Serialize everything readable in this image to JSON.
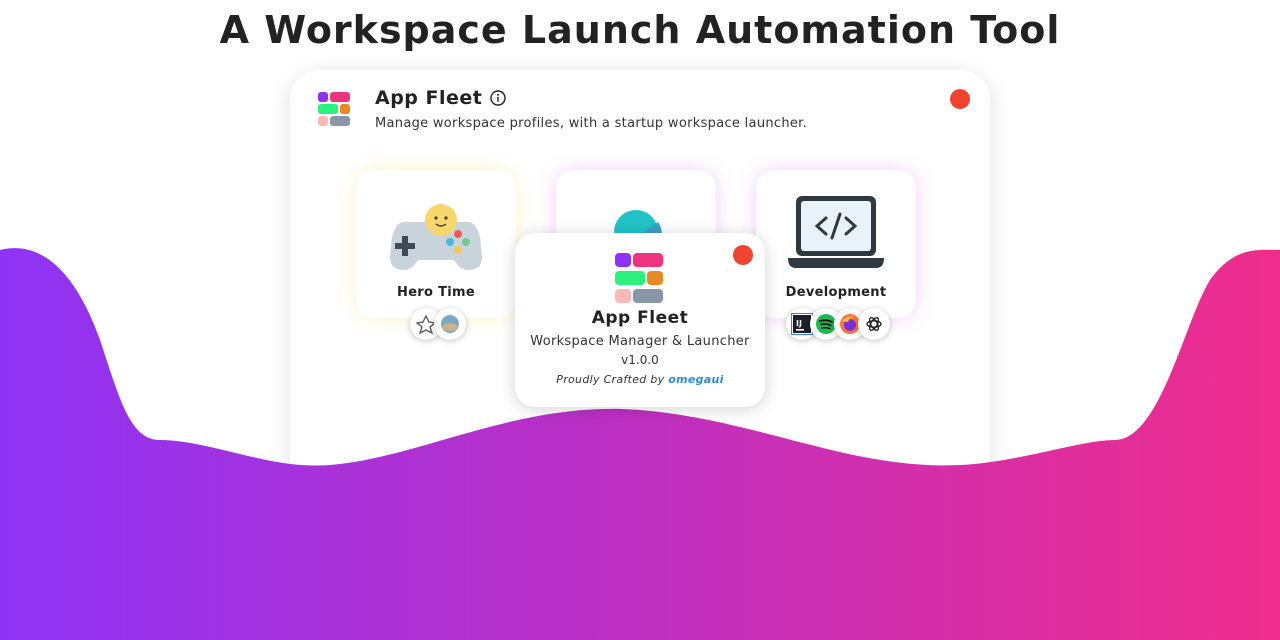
{
  "headline": "A Workspace Launch Automation Tool",
  "app": {
    "title": "App Fleet",
    "subtitle": "Manage workspace profiles, with a startup workspace launcher."
  },
  "workspaces": [
    {
      "label": "Hero Time",
      "icon": "gamepad-icon",
      "apps": [
        "game-app-1-icon",
        "game-app-2-icon"
      ]
    },
    {
      "label": "",
      "icon": "person-icon",
      "apps": []
    },
    {
      "label": "Development",
      "icon": "laptop-code-icon",
      "apps": [
        "intellij-icon",
        "spotify-icon",
        "firefox-icon",
        "openai-icon"
      ]
    }
  ],
  "about": {
    "name": "App Fleet",
    "description": "Workspace Manager & Launcher",
    "version": "v1.0.0",
    "credit_prefix": "Proudly Crafted by",
    "author": "omegaui"
  },
  "colors": {
    "close": "#f04430",
    "wave_start": "#8e33f5",
    "wave_end": "#ef2d8c",
    "author_link": "#2d8ad8"
  }
}
